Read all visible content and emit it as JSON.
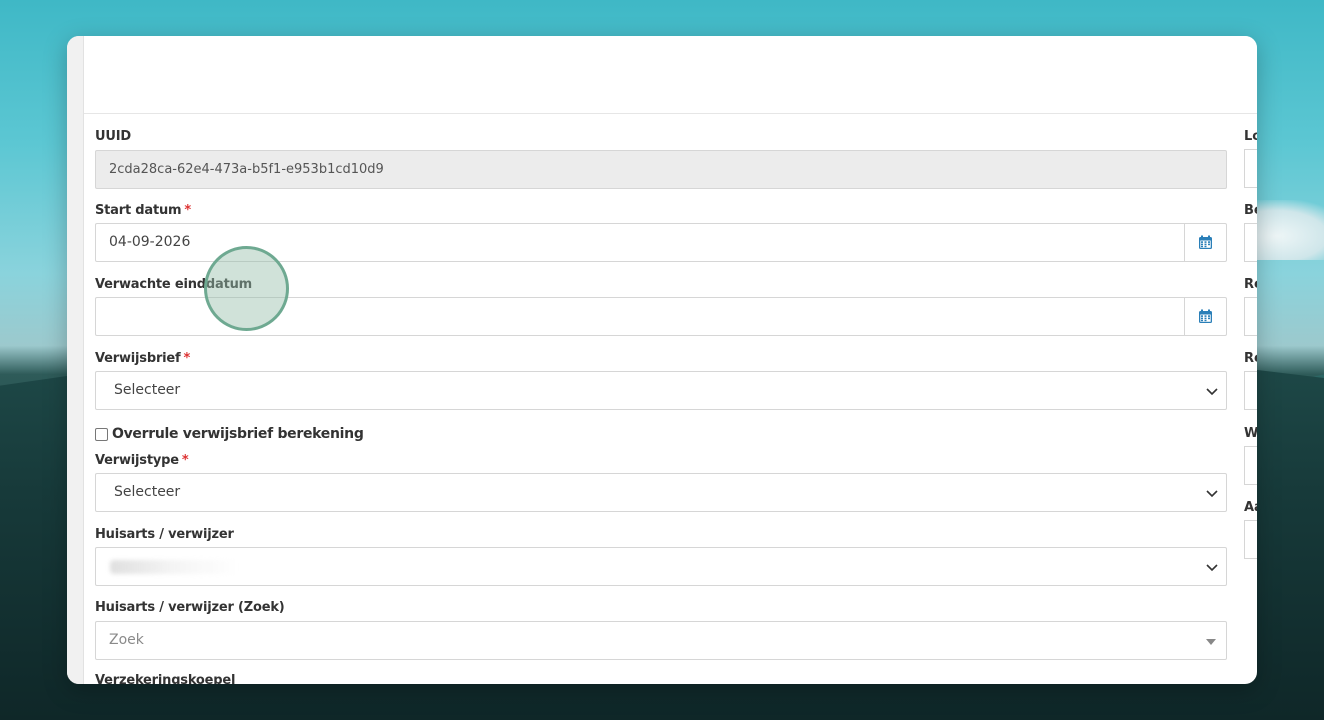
{
  "form": {
    "uuid": {
      "label": "UUID",
      "value": "2cda28ca-62e4-473a-b5f1-e953b1cd10d9"
    },
    "start_date": {
      "label": "Start datum",
      "required": "*",
      "value": "04-09-2026"
    },
    "expected_end_date": {
      "label": "Verwachte einddatum",
      "value": ""
    },
    "referral_letter": {
      "label": "Verwijsbrief",
      "required": "*",
      "value": "Selecteer"
    },
    "override_checkbox": {
      "label": "Overrule verwijsbrief berekening"
    },
    "referral_type": {
      "label": "Verwijstype",
      "required": "*",
      "value": "Selecteer"
    },
    "gp_referrer": {
      "label": "Huisarts / verwijzer"
    },
    "gp_referrer_search": {
      "label": "Huisarts / verwijzer (Zoek)",
      "placeholder": "Zoek"
    },
    "insurance_umbrella": {
      "label": "Verzekeringskoepel"
    }
  },
  "right_column_labels": [
    "Lo",
    "Be",
    "Re",
    "Re",
    "Wa",
    "Aa"
  ],
  "colors": {
    "required": "#dd3333",
    "calendar_icon": "#2a7fb8",
    "cursor": "#6ea991"
  }
}
